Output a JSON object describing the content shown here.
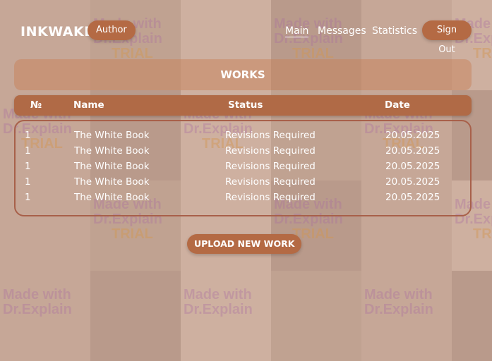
{
  "header": {
    "brand": "INKWAKE",
    "role": "Author",
    "nav": {
      "main": "Main",
      "messages": "Messages",
      "statistics": "Statistics"
    },
    "sign_out": "Sign Out"
  },
  "works": {
    "title": "WORKS",
    "columns": {
      "num": "№",
      "name": "Name",
      "status": "Status",
      "date": "Date"
    },
    "rows": [
      {
        "num": "1",
        "name": "The White Book",
        "status": "Revisions Required",
        "date": "20.05.2025"
      },
      {
        "num": "1",
        "name": "The White Book",
        "status": "Revisions Required",
        "date": "20.05.2025"
      },
      {
        "num": "1",
        "name": "The White Book",
        "status": "Revisions Required",
        "date": "20.05.2025"
      },
      {
        "num": "1",
        "name": "The White Book",
        "status": "Revisions Required",
        "date": "20.05.2025"
      },
      {
        "num": "1",
        "name": "The White Book",
        "status": "Revisions Required",
        "date": "20.05.2025"
      }
    ],
    "upload_label": "UPLOAD NEW WORK"
  },
  "watermark": {
    "line1": "Made with",
    "line2": "Dr.Explain",
    "line3": "TRIAL"
  }
}
